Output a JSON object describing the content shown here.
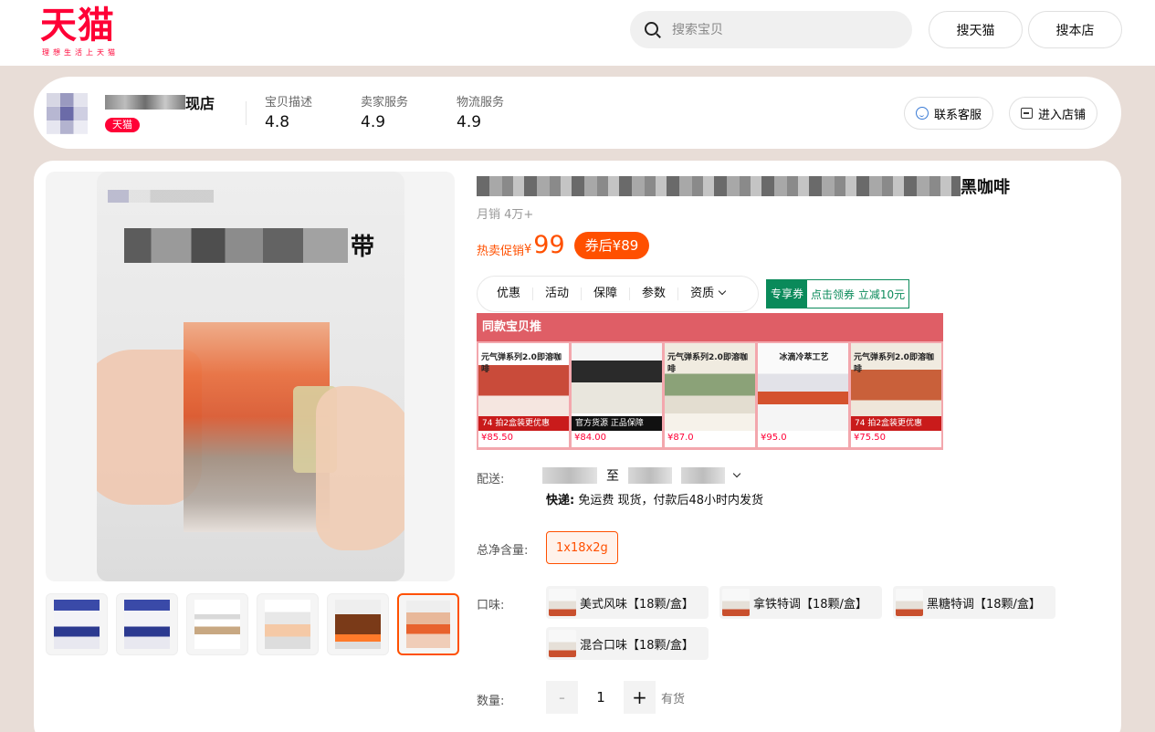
{
  "header": {
    "logo_text": "天猫",
    "logo_slogan": "理想生活上天猫",
    "search_placeholder": "搜索宝贝",
    "search_tmall_label": "搜天猫",
    "search_store_label": "搜本店"
  },
  "shop": {
    "name_suffix": "现店",
    "badge": "天猫",
    "ratings": [
      {
        "label": "宝贝描述",
        "value": "4.8"
      },
      {
        "label": "卖家服务",
        "value": "4.9"
      },
      {
        "label": "物流服务",
        "value": "4.9"
      }
    ],
    "contact_label": "联系客服",
    "enter_store_label": "进入店铺"
  },
  "product": {
    "title_suffix": "黑咖啡",
    "image_headline_tail": "带",
    "monthly_sales": "月销 4万+",
    "price_label": "热卖促销",
    "currency": "¥",
    "price": "99",
    "coupon_price": "券后¥89",
    "tabs": [
      "优惠",
      "活动",
      "保障",
      "参数",
      "资质"
    ],
    "exclusive": {
      "key": "专享券",
      "value": "点击领券 立减10元"
    },
    "recommend": {
      "header": "同款宝贝推",
      "items": [
        {
          "caption": "元气弹系列2.0即溶咖啡",
          "tag": "74 拍2盒装更优惠",
          "price": "¥85.50"
        },
        {
          "caption": "",
          "tag": "官方货源 正品保障",
          "price": "¥84.00"
        },
        {
          "caption": "元气弹系列2.0即溶咖啡",
          "tag": "",
          "price": "¥87.0"
        },
        {
          "caption": "冰滴冷萃工艺",
          "tag": "",
          "price": "¥95.0"
        },
        {
          "caption": "元气弹系列2.0即溶咖啡",
          "tag": "74 拍2盒装更优惠",
          "price": "¥75.50"
        }
      ]
    },
    "shipping": {
      "label": "配送:",
      "to": "至",
      "detail_key": "快递:",
      "detail_value": "免运费 现货，付款后48小时内发货"
    },
    "net_content": {
      "label": "总净含量:",
      "options": [
        "1x18x2g"
      ]
    },
    "flavor": {
      "label": "口味:",
      "options": [
        "美式风味【18颗/盒】",
        "拿铁特调【18颗/盒】",
        "黑糖特调【18颗/盒】",
        "混合口味【18颗/盒】"
      ]
    },
    "quantity": {
      "label": "数量:",
      "value": "1",
      "minus": "-",
      "plus": "+",
      "stock": "有货"
    }
  },
  "colors": {
    "accent": "#ff5000",
    "tmall_red": "#ff0036",
    "exclusive_green": "#0a8a5a"
  }
}
